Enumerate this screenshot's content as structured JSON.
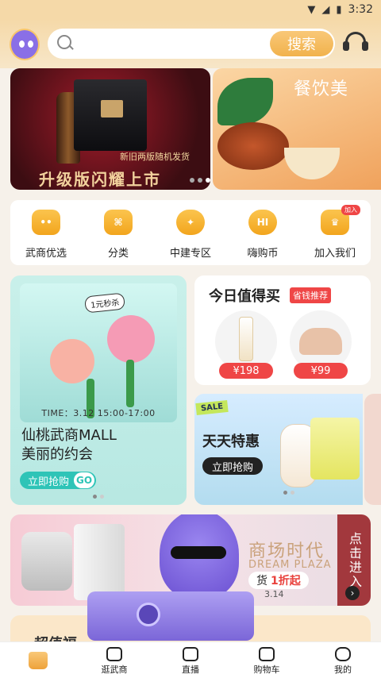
{
  "status_bar": {
    "time": "3:32"
  },
  "search": {
    "placeholder": "",
    "button": "搜索"
  },
  "banner": {
    "tagline": "新旧两版随机发货",
    "slogan": "升级版闪耀上市",
    "second_text": "餐饮美"
  },
  "nav": {
    "items": [
      {
        "label": "武商优选",
        "icon": "mascot-face-icon"
      },
      {
        "label": "分类",
        "icon": "category-ticket-icon"
      },
      {
        "label": "中建专区",
        "icon": "zhongjian-badge-icon"
      },
      {
        "label": "嗨购币",
        "icon": "coin-bag-icon"
      },
      {
        "label": "加入我们",
        "icon": "crown-icon",
        "badge": "加入"
      }
    ]
  },
  "promo_left": {
    "sign": "1元秒杀",
    "time": "TIME：3.12 15:00-17:00",
    "title_line1": "仙桃武商MALL",
    "title_line2": "美丽的约会",
    "cta": "立即抢购",
    "go": "GO"
  },
  "daily": {
    "title": "今日值得买",
    "tag": "省钱推荐",
    "products": [
      {
        "price": "¥198",
        "icon": "serum-bottle-icon"
      },
      {
        "price": "¥99",
        "icon": "bra-icon"
      }
    ]
  },
  "daydeal": {
    "sale": "SALE",
    "title": "天天特惠",
    "cta": "立即抢购"
  },
  "wide_banner": {
    "era": "商场时代",
    "dream": "DREAM PLAZA",
    "discount_prefix": "货",
    "discount": "1折起",
    "date": "3.14",
    "enter": "点击进入",
    "arrow": "›"
  },
  "bottom_card": {
    "title": "超值福"
  },
  "tabbar": {
    "items": [
      {
        "label": "",
        "icon": "home-icon"
      },
      {
        "label": "逛武商",
        "icon": "shopping-bag-icon"
      },
      {
        "label": "直播",
        "icon": "live-video-icon"
      },
      {
        "label": "购物车",
        "icon": "cart-icon"
      },
      {
        "label": "我的",
        "icon": "profile-face-icon"
      }
    ]
  },
  "colors": {
    "accent": "#f1b24c",
    "sale_red": "#ef4646",
    "teal": "#2ec4b7"
  }
}
